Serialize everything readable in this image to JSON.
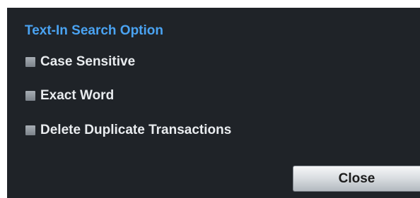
{
  "dialog": {
    "title": "Text-In Search Option",
    "options": [
      {
        "label": "Case Sensitive",
        "checked": false
      },
      {
        "label": "Exact Word",
        "checked": false
      },
      {
        "label": "Delete Duplicate Transactions",
        "checked": false
      }
    ],
    "close_label": "Close"
  },
  "colors": {
    "background": "#1f2328",
    "title": "#4aa3f2",
    "text": "#e9ecef",
    "checkbox": "#8f969d"
  }
}
